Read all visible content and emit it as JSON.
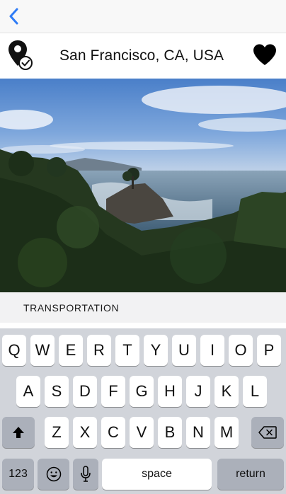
{
  "nav": {
    "back_icon": "chevron-left-icon"
  },
  "header": {
    "location": "San Francisco, CA, USA",
    "pin_icon": "location-pin-check-icon",
    "favorite_icon": "heart-icon"
  },
  "photo": {
    "subject": "coastal-cypress-scene"
  },
  "section": {
    "title": "TRANSPORTATION"
  },
  "keyboard": {
    "row1": [
      "Q",
      "W",
      "E",
      "R",
      "T",
      "Y",
      "U",
      "I",
      "O",
      "P"
    ],
    "row2": [
      "A",
      "S",
      "D",
      "F",
      "G",
      "H",
      "J",
      "K",
      "L"
    ],
    "row3": [
      "Z",
      "X",
      "C",
      "V",
      "B",
      "N",
      "M"
    ],
    "numbers_label": "123",
    "space_label": "space",
    "return_label": "return",
    "shift_icon": "shift-icon",
    "delete_icon": "delete-icon",
    "emoji_icon": "emoji-icon",
    "mic_icon": "microphone-icon"
  },
  "colors": {
    "accent": "#2f7cf6",
    "keyboard_bg": "#d1d4da",
    "special_key": "#abb0ba"
  }
}
